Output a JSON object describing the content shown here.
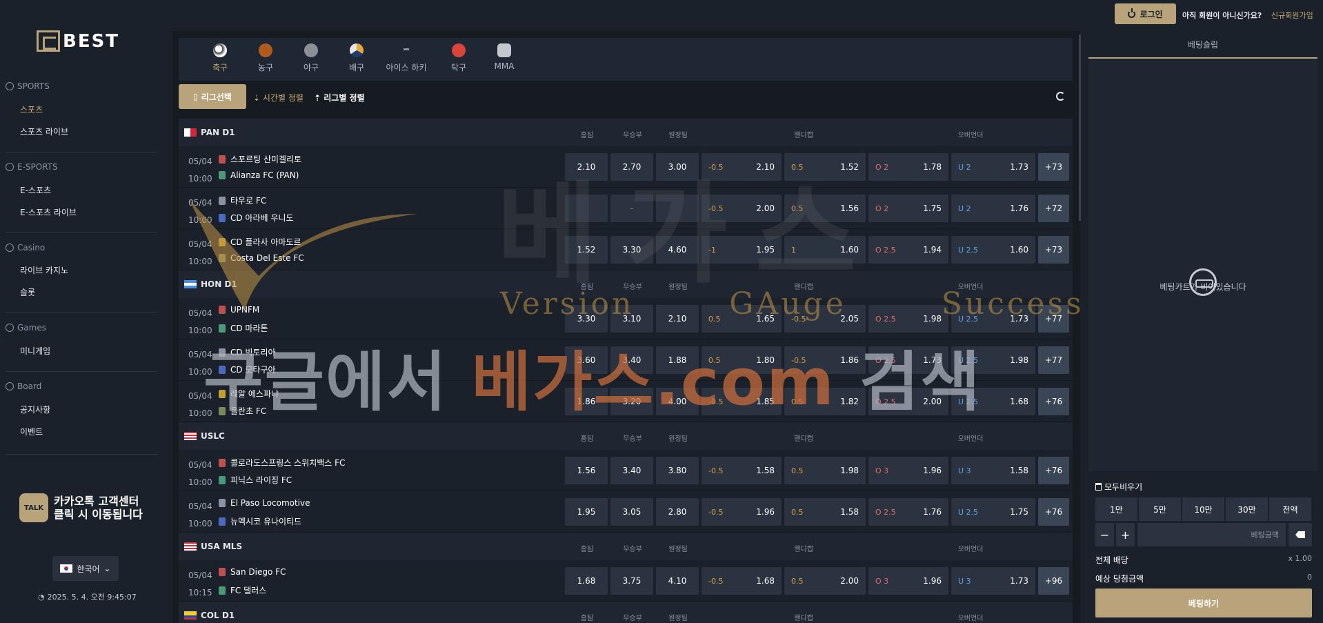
{
  "topbar": {
    "login_label": "로그인",
    "not_member": "아직 회원이 아니신가요?",
    "signup": "신규회원가입"
  },
  "sidebar": {
    "logo_text": "BEST",
    "sections": [
      {
        "label": "SPORTS",
        "items": [
          "스포츠",
          "스포츠 라이브"
        ]
      },
      {
        "label": "E-SPORTS",
        "items": [
          "E-스포츠",
          "E-스포츠 라이브"
        ]
      },
      {
        "label": "Casino",
        "items": [
          "라이브 카지노",
          "슬롯"
        ]
      },
      {
        "label": "Games",
        "items": [
          "미니게임"
        ]
      },
      {
        "label": "Board",
        "items": [
          "공지사항",
          "이벤트"
        ]
      }
    ],
    "kakao_line1": "카카오톡 고객센터",
    "kakao_line2": "클릭 시 이동됩니다",
    "kakao_icon_text": "TALK",
    "language": "한국어",
    "datetime": "2025. 5. 4. 오전 9:45:07"
  },
  "sport_tabs": [
    "축구",
    "농구",
    "야구",
    "배구",
    "아이스 하키",
    "탁구",
    "MMA"
  ],
  "sort": {
    "league_select": "리그선택",
    "by_time": "시간별 정렬",
    "by_league": "리그별 정렬"
  },
  "columns": {
    "home": "홈팀",
    "draw": "무승부",
    "away": "원정팀",
    "handicap": "핸디캡",
    "overunder": "오버언더"
  },
  "leagues": [
    {
      "name": "PAN D1",
      "matches": [
        {
          "date": "05/04",
          "time": "10:00",
          "home": "스포르팅 산미겔리토",
          "away": "Alianza FC (PAN)",
          "h": "2.10",
          "d": "2.70",
          "a": "3.00",
          "hc1": "-0.5",
          "hv1": "2.10",
          "hc2": "0.5",
          "hv2": "1.52",
          "o": "O 2",
          "ov": "1.78",
          "u": "U 2",
          "uv": "1.73",
          "more": "+73"
        },
        {
          "date": "05/04",
          "time": "10:00",
          "home": "타우로 FC",
          "away": "CD 아라베 우니도",
          "h": "",
          "d": "-",
          "a": "",
          "hc1": "-0.5",
          "hv1": "2.00",
          "hc2": "0.5",
          "hv2": "1.56",
          "o": "O 2",
          "ov": "1.75",
          "u": "U 2",
          "uv": "1.76",
          "more": "+72"
        },
        {
          "date": "05/04",
          "time": "10:00",
          "home": "CD 플라사 아마도르",
          "away": "Costa Del Este FC",
          "h": "1.52",
          "d": "3.30",
          "a": "4.60",
          "hc1": "-1",
          "hv1": "1.95",
          "hc2": "1",
          "hv2": "1.60",
          "o": "O 2.5",
          "ov": "1.94",
          "u": "U 2.5",
          "uv": "1.60",
          "more": "+73"
        }
      ]
    },
    {
      "name": "HON D1",
      "matches": [
        {
          "date": "05/04",
          "time": "10:00",
          "home": "UPNFM",
          "away": "CD 마라톤",
          "h": "3.30",
          "d": "3.10",
          "a": "2.10",
          "hc1": "0.5",
          "hv1": "1.65",
          "hc2": "-0.5",
          "hv2": "2.05",
          "o": "O 2.5",
          "ov": "1.98",
          "u": "U 2.5",
          "uv": "1.73",
          "more": "+77"
        },
        {
          "date": "05/04",
          "time": "10:00",
          "home": "CD 빅토리아",
          "away": "CD 모타구아",
          "h": "3.60",
          "d": "3.40",
          "a": "1.88",
          "hc1": "0.5",
          "hv1": "1.80",
          "hc2": "-0.5",
          "hv2": "1.86",
          "o": "O 2.5",
          "ov": "1.73",
          "u": "U 2.5",
          "uv": "1.98",
          "more": "+77"
        },
        {
          "date": "05/04",
          "time": "10:00",
          "home": "레알 에스파냐",
          "away": "올란초 FC",
          "h": "1.86",
          "d": "3.20",
          "a": "4.00",
          "hc1": "-0.5",
          "hv1": "1.85",
          "hc2": "0.5",
          "hv2": "1.82",
          "o": "O 2.5",
          "ov": "2.00",
          "u": "U 2.5",
          "uv": "1.68",
          "more": "+76"
        }
      ]
    },
    {
      "name": "USLC",
      "matches": [
        {
          "date": "05/04",
          "time": "10:00",
          "home": "콜로라도스프링스 스위치백스 FC",
          "away": "피닉스 라이징 FC",
          "h": "1.56",
          "d": "3.40",
          "a": "3.80",
          "hc1": "-0.5",
          "hv1": "1.58",
          "hc2": "0.5",
          "hv2": "1.98",
          "o": "O 3",
          "ov": "1.96",
          "u": "U 3",
          "uv": "1.58",
          "more": "+76"
        },
        {
          "date": "05/04",
          "time": "10:00",
          "home": "El Paso Locomotive",
          "away": "뉴멕시코 유나이티드",
          "h": "1.95",
          "d": "3.05",
          "a": "2.80",
          "hc1": "-0.5",
          "hv1": "1.96",
          "hc2": "0.5",
          "hv2": "1.58",
          "o": "O 2.5",
          "ov": "1.76",
          "u": "U 2.5",
          "uv": "1.75",
          "more": "+76"
        }
      ]
    },
    {
      "name": "USA MLS",
      "matches": [
        {
          "date": "05/04",
          "time": "10:15",
          "home": "San Diego FC",
          "away": "FC 댈러스",
          "h": "1.68",
          "d": "3.75",
          "a": "4.10",
          "hc1": "-0.5",
          "hv1": "1.68",
          "hc2": "0.5",
          "hv2": "2.00",
          "o": "O 3",
          "ov": "1.96",
          "u": "U 3",
          "uv": "1.73",
          "more": "+96"
        }
      ]
    },
    {
      "name": "COL D1",
      "matches": []
    }
  ],
  "slip": {
    "title": "베팅슬립",
    "empty": "베팅카트가 비어있습니다",
    "clear_all": "모두비우기",
    "amounts": [
      "1만",
      "5만",
      "10만",
      "30만",
      "전액"
    ],
    "minus": "−",
    "plus": "+",
    "amount_placeholder": "베팅금액",
    "total_odds_label": "전체 배당",
    "total_odds_value": "x 1.00",
    "expected_label": "예상 당첨금액",
    "expected_value": "0",
    "bet_label": "베팅하기"
  },
  "watermark": {
    "big": "베가스",
    "sub": "Version GAuge Success",
    "main_a": "구글에서 ",
    "main_b": "베가스.com",
    "main_c": " 검색"
  },
  "colors": {
    "accent": "#b9a37b",
    "bg": "#1b212b",
    "cell": "#2b3340",
    "over": "#e46b6b",
    "under": "#5fa3e6"
  }
}
